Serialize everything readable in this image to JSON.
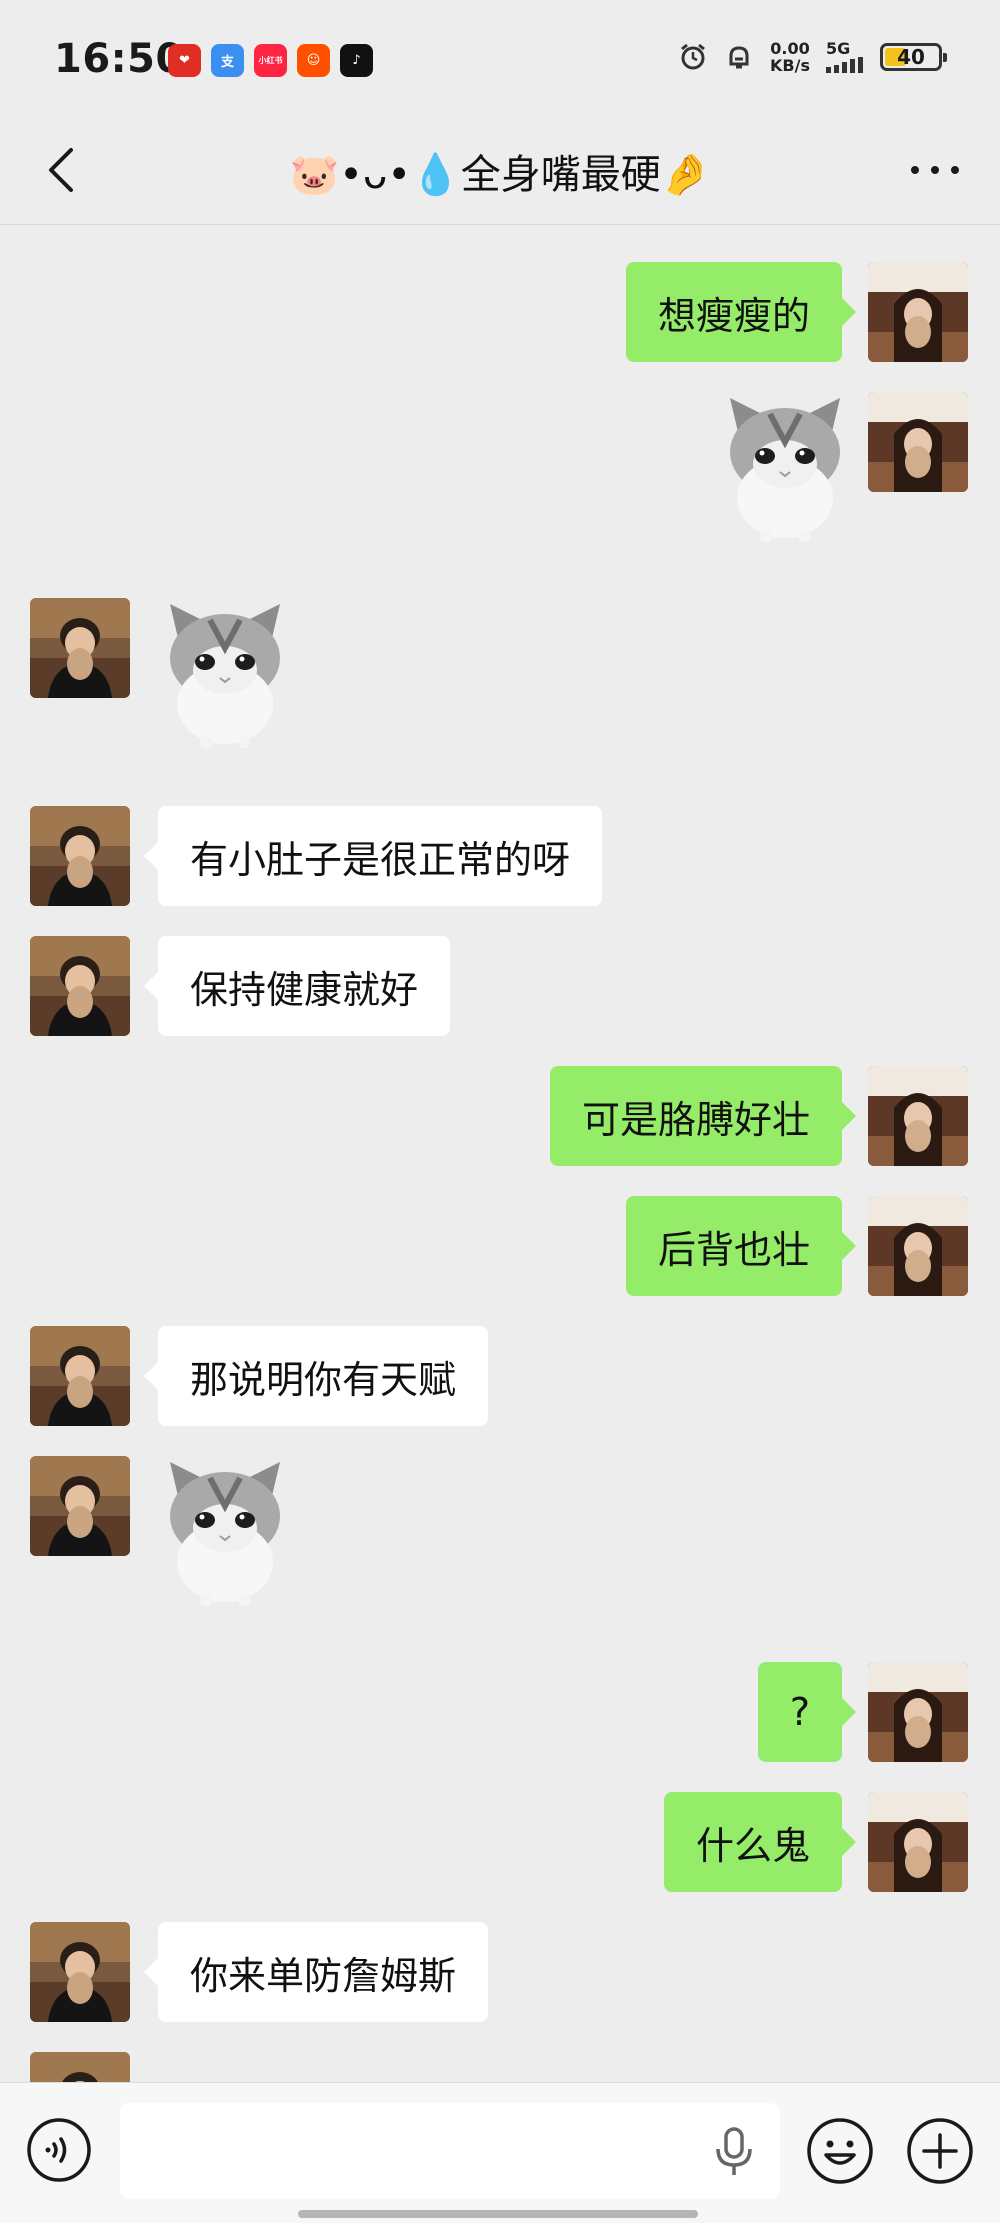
{
  "status_bar": {
    "time": "16:50",
    "net_speed_value": "0.00",
    "net_speed_unit": "KB/s",
    "network_type": "5G",
    "battery_level": "40",
    "battery_fraction": 0.4,
    "app_icons": [
      "pinduoduo-icon",
      "alipay-icon",
      "xiaohongshu-icon",
      "taobao-icon",
      "douyin-icon"
    ],
    "xiaohongshu_label": "小红书"
  },
  "header": {
    "title": "🐷•ᴗ•💧全身嘴最硬🤌"
  },
  "colors": {
    "background": "#ededed",
    "sent_bubble": "#95ec69",
    "received_bubble": "#ffffff"
  },
  "messages": [
    {
      "sender": "me",
      "type": "text",
      "text": "想瘦瘦的"
    },
    {
      "sender": "me",
      "type": "sticker",
      "sticker": "cat-sticker"
    },
    {
      "sender": "other",
      "type": "sticker",
      "sticker": "cat-sticker"
    },
    {
      "sender": "other",
      "type": "text",
      "text": "有小肚子是很正常的呀"
    },
    {
      "sender": "other",
      "type": "text",
      "text": "保持健康就好"
    },
    {
      "sender": "me",
      "type": "text",
      "text": "可是胳膊好壮"
    },
    {
      "sender": "me",
      "type": "text",
      "text": "后背也壮"
    },
    {
      "sender": "other",
      "type": "text",
      "text": "那说明你有天赋"
    },
    {
      "sender": "other",
      "type": "sticker",
      "sticker": "cat-sticker"
    },
    {
      "sender": "me",
      "type": "text",
      "text": "?"
    },
    {
      "sender": "me",
      "type": "text",
      "text": "什么鬼"
    },
    {
      "sender": "other",
      "type": "text",
      "text": "你来单防詹姆斯"
    }
  ],
  "input_bar": {
    "placeholder": ""
  }
}
